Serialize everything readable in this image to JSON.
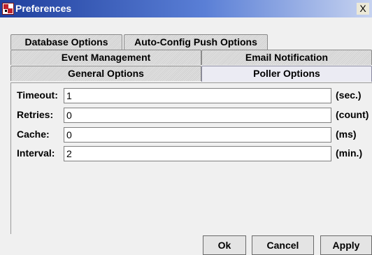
{
  "window": {
    "title": "Preferences",
    "close_label": "X"
  },
  "tabs": {
    "row1": [
      "Database Options",
      "Auto-Config Push Options"
    ],
    "row2": [
      "Event Management",
      "Email Notification"
    ],
    "row3": [
      "General Options",
      "Poller Options"
    ],
    "active": "Poller Options"
  },
  "poller": {
    "timeout": {
      "label": "Timeout:",
      "value": "1",
      "unit": "(sec.)"
    },
    "retries": {
      "label": "Retries:",
      "value": "0",
      "unit": "(count)"
    },
    "cache": {
      "label": "Cache:",
      "value": "0",
      "unit": "(ms)"
    },
    "interval": {
      "label": "Interval:",
      "value": "2",
      "unit": "(min.)"
    }
  },
  "buttons": {
    "ok": "Ok",
    "cancel": "Cancel",
    "apply": "Apply"
  }
}
